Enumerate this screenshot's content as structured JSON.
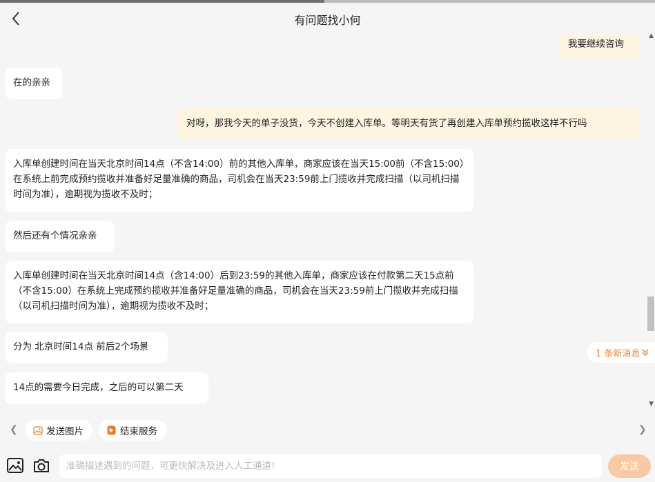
{
  "header": {
    "title": "有问题找小何"
  },
  "messages": [
    {
      "side": "out",
      "text": "我要继续咨询"
    },
    {
      "side": "in",
      "text": "在的亲亲"
    },
    {
      "side": "out",
      "text": "对呀，那我今天的单子没货，今天不创建入库单。等明天有货了再创建入库单预约揽收这样不行吗"
    },
    {
      "side": "in",
      "text": "入库单创建时间在当天北京时间14点（不含14:00）前的其他入库单，商家应该在当天15:00前（不含15:00）在系统上前完成预约揽收并准备好足量准确的商品，司机会在当天23:59前上门揽收并完成扫描（以司机扫描时间为准），逾期视为揽收不及时；"
    },
    {
      "side": "in",
      "text": "然后还有个情况亲亲"
    },
    {
      "side": "in",
      "text": "入库单创建时间在当天北京时间14点（含14:00）后到23:59的其他入库单，商家应该在付款第二天15点前（不含15:00）在系统上完成预约揽收并准备好足量准确的商品，司机会在当天23:59前上门揽收并完成扫描（以司机扫描时间为准），逾期视为揽收不及时；"
    },
    {
      "side": "in",
      "text": "分为 北京时间14点 前后2个场景"
    },
    {
      "side": "in",
      "text": "14点的需要今日完成，之后的可以第二天"
    }
  ],
  "new_message_badge": {
    "label": "1 条新消息"
  },
  "quick_actions": [
    {
      "label": "发送图片",
      "icon": "image-icon"
    },
    {
      "label": "结束服务",
      "icon": "exit-icon"
    }
  ],
  "composer": {
    "placeholder": "准确描述遇到的问题，可更快解决及进入人工通道!",
    "value": "",
    "send_label": "发送"
  },
  "colors": {
    "accent": "#e8843a",
    "outgoing_bubble": "#fdf5e2",
    "incoming_bubble": "#ffffff",
    "send_button": "#f8c9a6",
    "exit_icon": "#f07a22"
  }
}
